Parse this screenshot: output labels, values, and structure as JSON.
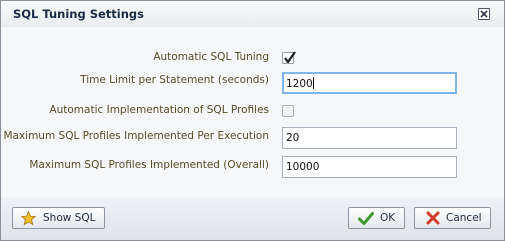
{
  "dialog": {
    "title": "SQL Tuning Settings",
    "close_icon": "close-icon"
  },
  "settings": {
    "automatic_sql_tuning": {
      "label": "Automatic SQL Tuning",
      "checked": true
    },
    "time_limit": {
      "label": "Time Limit per Statement (seconds)",
      "value": "1200"
    },
    "auto_impl_profiles": {
      "label": "Automatic Implementation of SQL Profiles",
      "checked": false
    },
    "max_per_execution": {
      "label": "Maximum SQL Profiles Implemented Per Execution",
      "value": "20"
    },
    "max_overall": {
      "label": "Maximum SQL Profiles Implemented (Overall)",
      "value": "10000"
    }
  },
  "buttons": {
    "show_sql": {
      "label": "Show SQL",
      "icon": "star-icon"
    },
    "ok": {
      "label": "OK",
      "icon": "checkmark-icon"
    },
    "cancel": {
      "label": "Cancel",
      "icon": "x-icon"
    }
  },
  "colors": {
    "label_text": "#564a27",
    "title_text": "#1b2a45",
    "focus_border": "#7fb5e6"
  }
}
